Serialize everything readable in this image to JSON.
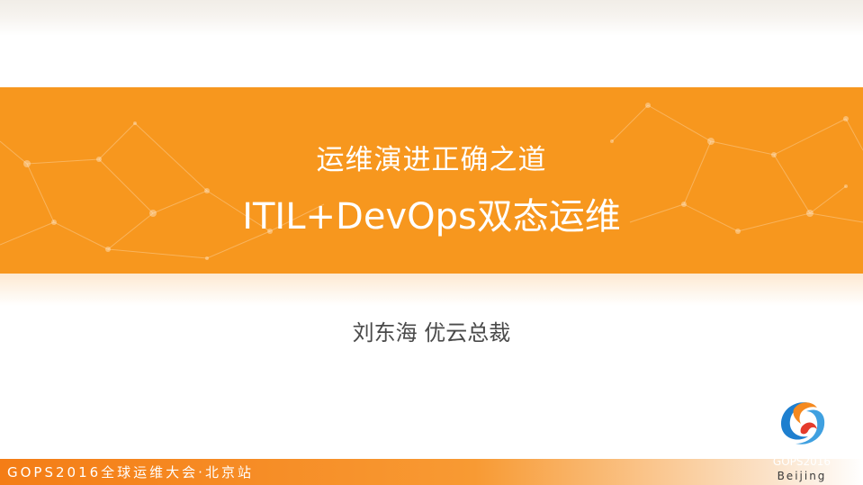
{
  "slide": {
    "title_line1": "运维演进正确之道",
    "title_line2": "ITIL+DevOps双态运维",
    "author": "刘东海  优云总裁"
  },
  "footer": {
    "event": "GOPS2016全球运维大会·北京站"
  },
  "logo": {
    "line1": "GOPS2016",
    "line2": "Beijing",
    "icon": "gops-swirl-logo-icon"
  },
  "colors": {
    "banner": "#f7971e",
    "footer": "#f47d16",
    "logo_blue": "#1e7fcf",
    "logo_orange": "#f5891f",
    "logo_red": "#e53b2c"
  }
}
